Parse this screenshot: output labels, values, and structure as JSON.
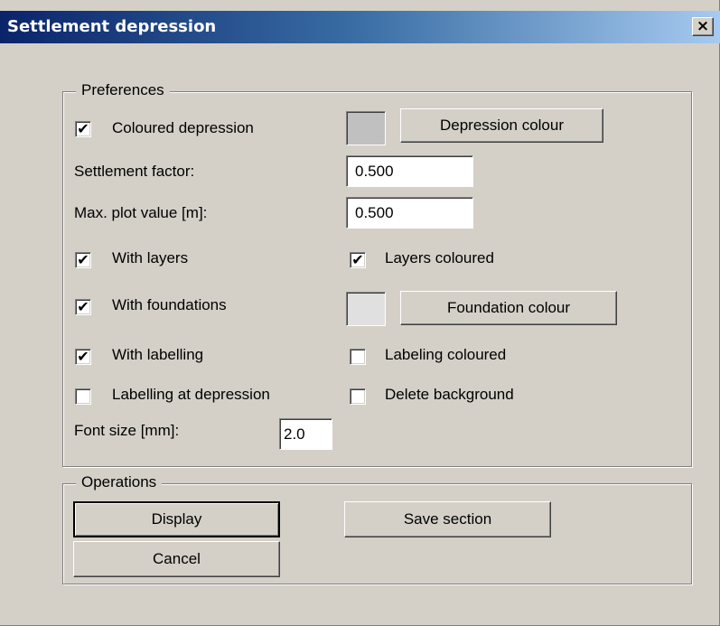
{
  "window": {
    "title": "Settlement depression",
    "close_glyph": "×"
  },
  "preferences": {
    "legend": "Preferences",
    "coloured_depression": {
      "label": "Coloured depression",
      "checked": true
    },
    "depression_colour": {
      "label": "Depression colour",
      "swatch": "#c0c0c0"
    },
    "settlement_factor": {
      "label": "Settlement factor:",
      "value": "0.500"
    },
    "max_plot_value": {
      "label": "Max. plot value [m]:",
      "value": "0.500"
    },
    "with_layers": {
      "label": "With layers",
      "checked": true
    },
    "layers_coloured": {
      "label": "Layers coloured",
      "checked": true
    },
    "with_foundations": {
      "label": "With foundations",
      "checked": true
    },
    "foundation_colour": {
      "label": "Foundation colour",
      "swatch": "#e0e0e0"
    },
    "with_labelling": {
      "label": "With labelling",
      "checked": true
    },
    "labeling_coloured": {
      "label": "Labeling coloured",
      "checked": false
    },
    "labelling_at_depression": {
      "label": "Labelling at depression",
      "checked": false
    },
    "delete_background": {
      "label": "Delete background",
      "checked": false
    },
    "font_size": {
      "label": "Font size [mm]:",
      "value": "2.0"
    }
  },
  "operations": {
    "legend": "Operations",
    "display_label": "Display",
    "save_section_label": "Save section",
    "cancel_label": "Cancel"
  },
  "check_glyph": "✔"
}
